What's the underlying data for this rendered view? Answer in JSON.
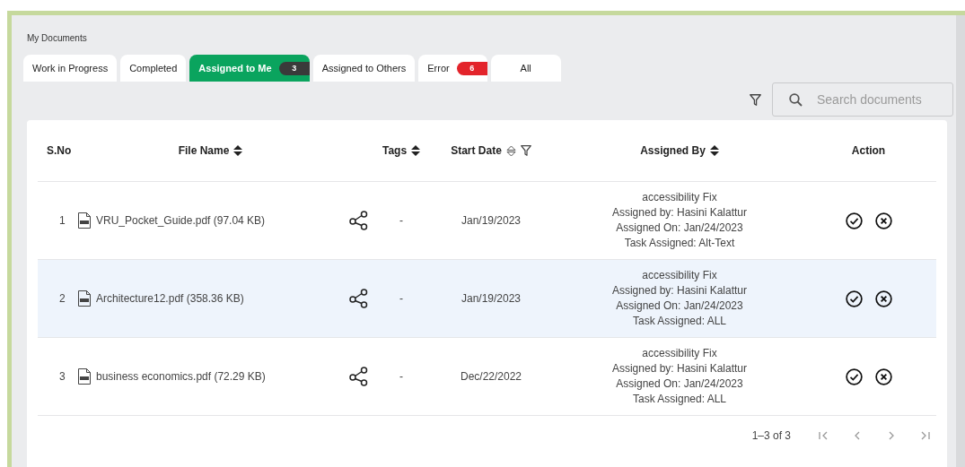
{
  "page_title": "My Documents",
  "tabs": [
    {
      "label": "Work in Progress",
      "selected": false
    },
    {
      "label": "Completed",
      "selected": false
    },
    {
      "label": "Assigned to Me",
      "selected": true,
      "badge": {
        "text": "3",
        "color": "#3a3a3a"
      }
    },
    {
      "label": "Assigned to Others",
      "selected": false
    },
    {
      "label": "Error",
      "selected": false,
      "badge": {
        "text": "6",
        "color": "#e3242b"
      }
    },
    {
      "label": "All",
      "selected": false
    }
  ],
  "search": {
    "placeholder": "Search documents"
  },
  "table": {
    "columns": [
      {
        "label": "S.No",
        "sortable": false,
        "filter": false
      },
      {
        "label": "File Name",
        "sortable": true,
        "sort_outlined": false,
        "filter": false
      },
      {
        "label": "Tags",
        "sortable": true,
        "sort_outlined": false,
        "filter": false
      },
      {
        "label": "Start Date",
        "sortable": true,
        "sort_outlined": true,
        "filter": true
      },
      {
        "label": "Assigned By",
        "sortable": true,
        "sort_outlined": false,
        "filter": false
      },
      {
        "label": "Action",
        "sortable": false,
        "filter": false
      }
    ],
    "rows": [
      {
        "sno": "1",
        "file": "VRU_Pocket_Guide.pdf (97.04 KB)",
        "tags": "-",
        "start_date": "Jan/19/2023",
        "assigned": [
          "accessibility Fix",
          "Assigned by: Hasini Kalattur",
          "Assigned On: Jan/24/2023",
          "Task Assigned: Alt-Text"
        ],
        "selected": false
      },
      {
        "sno": "2",
        "file": "Architecture12.pdf (358.36 KB)",
        "tags": "-",
        "start_date": "Jan/19/2023",
        "assigned": [
          "accessibility Fix",
          "Assigned by: Hasini Kalattur",
          "Assigned On: Jan/24/2023",
          "Task Assigned: ALL"
        ],
        "selected": true
      },
      {
        "sno": "3",
        "file": "business economics.pdf (72.29 KB)",
        "tags": "-",
        "start_date": "Dec/22/2022",
        "assigned": [
          "accessibility Fix",
          "Assigned by: Hasini Kalattur",
          "Assigned On: Jan/24/2023",
          "Task Assigned: ALL"
        ],
        "selected": false
      }
    ]
  },
  "pagination": {
    "range": "1–3 of 3"
  }
}
